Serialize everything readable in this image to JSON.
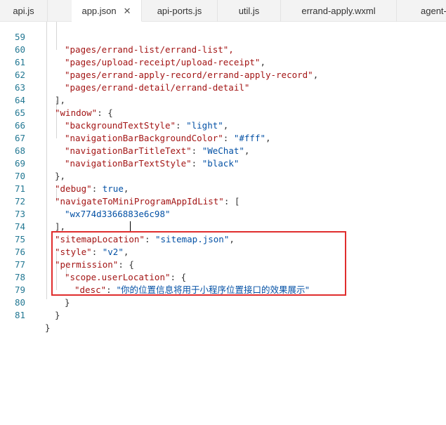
{
  "tabs": [
    {
      "label": "api.js"
    },
    {
      "label": "app.json",
      "close": "✕"
    },
    {
      "label": "api-ports.js"
    },
    {
      "label": "util.js"
    },
    {
      "label": "errand-apply.wxml"
    },
    {
      "label": "agent-"
    }
  ],
  "code": {
    "lines": [
      {
        "n": "59",
        "parts": [
          "\"pages/errand-list/errand-list\",",
          ""
        ]
      },
      {
        "n": "60",
        "parts": [
          "\"pages/upload-receipt/upload-receipt\"",
          ","
        ]
      },
      {
        "n": "61",
        "parts": [
          "\"pages/errand-apply-record/errand-apply-record\"",
          ","
        ]
      },
      {
        "n": "62",
        "parts": [
          "\"pages/errand-detail/errand-detail\"",
          ""
        ]
      },
      {
        "n": "63",
        "parts": [
          "],"
        ]
      },
      {
        "n": "64",
        "parts": [
          "\"window\"",
          ": {"
        ]
      },
      {
        "n": "65",
        "parts": [
          "\"backgroundTextStyle\"",
          ": ",
          "\"light\"",
          ","
        ]
      },
      {
        "n": "66",
        "parts": [
          "\"navigationBarBackgroundColor\"",
          ": ",
          "\"#fff\"",
          ","
        ]
      },
      {
        "n": "67",
        "parts": [
          "\"navigationBarTitleText\"",
          ": ",
          "\"WeChat\"",
          ","
        ]
      },
      {
        "n": "68",
        "parts": [
          "\"navigationBarTextStyle\"",
          ": ",
          "\"black\""
        ]
      },
      {
        "n": "69",
        "parts": [
          "},"
        ]
      },
      {
        "n": "70",
        "parts": [
          "\"debug\"",
          ": ",
          "true",
          ","
        ]
      },
      {
        "n": "71",
        "parts": [
          "\"navigateToMiniProgramAppIdList\"",
          ": ["
        ]
      },
      {
        "n": "72",
        "parts": [
          "\"wx774d3366883e6c98\""
        ]
      },
      {
        "n": "73",
        "parts": [
          "],"
        ]
      },
      {
        "n": "74",
        "parts": [
          "\"sitemapLocation\"",
          ": ",
          "\"sitemap.json\"",
          ","
        ]
      },
      {
        "n": "75",
        "parts": [
          "\"style\"",
          ": ",
          "\"v2\"",
          ","
        ]
      },
      {
        "n": "76",
        "parts": [
          "\"permission\"",
          ": {"
        ]
      },
      {
        "n": "77",
        "parts": [
          "\"scope.userLocation\"",
          ": {"
        ]
      },
      {
        "n": "78",
        "parts": [
          "\"desc\"",
          ": ",
          "\"你的位置信息将用于小程序位置接口的效果展示\""
        ]
      },
      {
        "n": "79",
        "parts": [
          "}"
        ]
      },
      {
        "n": "80",
        "parts": [
          "}"
        ]
      },
      {
        "n": "81",
        "parts": [
          "}"
        ]
      }
    ]
  },
  "colors": {
    "key": "#a31515",
    "value": "#0451a5",
    "line_number": "#237893",
    "highlight_box": "#e02d2d"
  }
}
